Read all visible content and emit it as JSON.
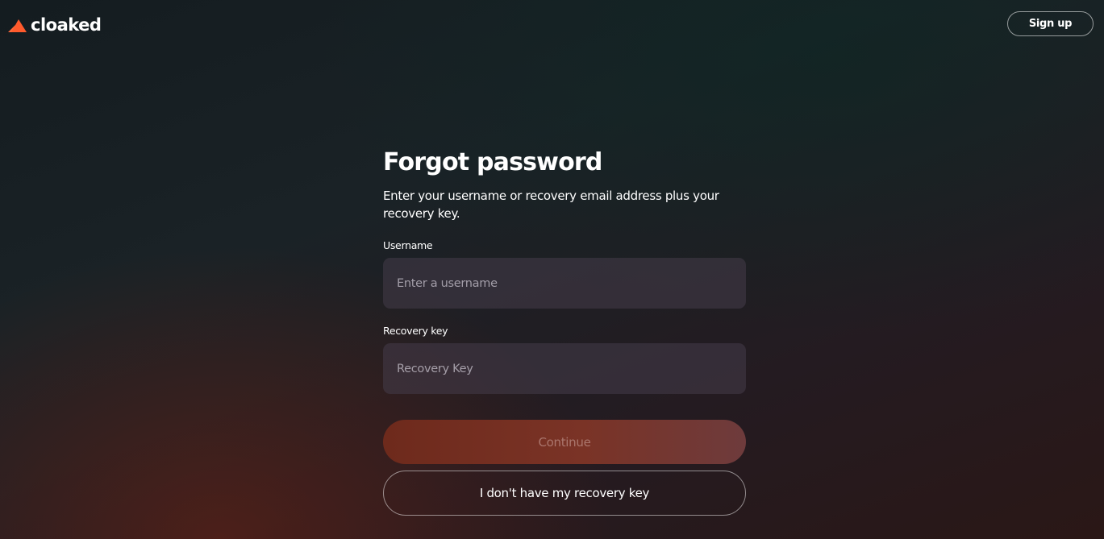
{
  "header": {
    "logo_text": "cloaked",
    "logo_icon": "cloaked-logo-icon",
    "signup_label": "Sign up"
  },
  "form": {
    "title": "Forgot password",
    "subtitle": "Enter your username or recovery email address plus your recovery key.",
    "username": {
      "label": "Username",
      "placeholder": "Enter a username",
      "value": ""
    },
    "recovery": {
      "label": "Recovery key",
      "placeholder": "Recovery Key",
      "value": ""
    },
    "continue_label": "Continue",
    "continue_disabled": true,
    "no_recovery_label": "I don't have my recovery key"
  },
  "colors": {
    "brand_orange": "#ff5a2c",
    "continue_bg": "#7a3326"
  }
}
